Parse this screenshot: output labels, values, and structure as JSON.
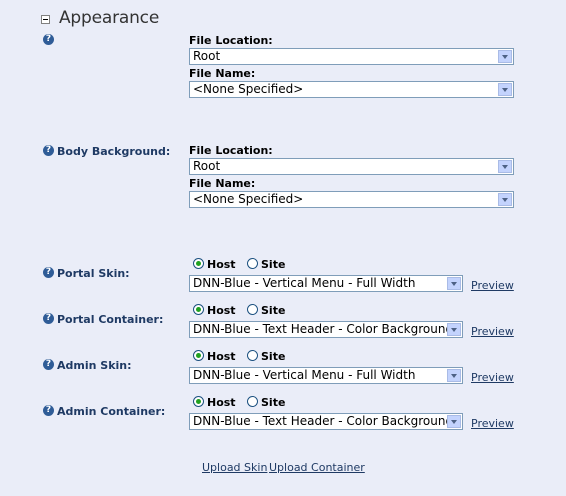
{
  "section": {
    "title": "Appearance"
  },
  "logo": {
    "file_location_label": "File Location:",
    "file_location_value": "Root",
    "file_name_label": "File Name:",
    "file_name_value": "<None Specified>"
  },
  "body_background": {
    "label": "Body Background:",
    "file_location_label": "File Location:",
    "file_location_value": "Root",
    "file_name_label": "File Name:",
    "file_name_value": "<None Specified>"
  },
  "skins": [
    {
      "label": "Portal Skin:",
      "host_label": "Host",
      "site_label": "Site",
      "selected": "host",
      "value": "DNN-Blue - Vertical Menu - Full Width",
      "preview_label": "Preview"
    },
    {
      "label": "Portal Container:",
      "host_label": "Host",
      "site_label": "Site",
      "selected": "host",
      "value": "DNN-Blue - Text Header - Color Background",
      "preview_label": "Preview"
    },
    {
      "label": "Admin Skin:",
      "host_label": "Host",
      "site_label": "Site",
      "selected": "host",
      "value": "DNN-Blue - Vertical Menu - Full Width",
      "preview_label": "Preview"
    },
    {
      "label": "Admin Container:",
      "host_label": "Host",
      "site_label": "Site",
      "selected": "host",
      "value": "DNN-Blue - Text Header - Color Background",
      "preview_label": "Preview"
    }
  ],
  "footer": {
    "upload_skin_label": "Upload Skin",
    "upload_container_label": "Upload Container"
  },
  "help_icon": "?"
}
